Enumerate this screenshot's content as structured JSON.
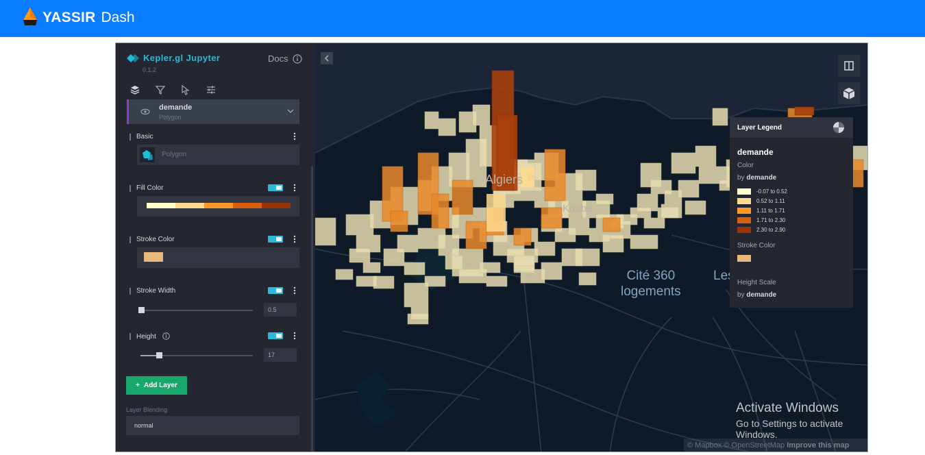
{
  "app": {
    "brand": "YASSIR",
    "title": "Dash"
  },
  "panel": {
    "title": "Kepler.gl Jupyter",
    "version": "0.1.2",
    "docs_label": "Docs",
    "tabs": [
      "layers-icon",
      "filter-icon",
      "interaction-icon",
      "settings-icon"
    ],
    "layer": {
      "name": "demande",
      "type": "Polygon"
    },
    "sections": {
      "basic": {
        "label": "Basic",
        "layer_type": "Polygon"
      },
      "fill_color": {
        "label": "Fill Color",
        "ramp": [
          "#ffffcc",
          "#fed98e",
          "#fe9929",
          "#d95f0e",
          "#993404"
        ]
      },
      "stroke_color": {
        "label": "Stroke Color",
        "color": "#e9b87c"
      },
      "stroke_width": {
        "label": "Stroke Width",
        "value": "0.5"
      },
      "height": {
        "label": "Height",
        "value": "17"
      }
    },
    "add_layer_label": "Add Layer",
    "blending_label": "Layer Blending",
    "blending_value": "normal"
  },
  "legend": {
    "title": "Layer Legend",
    "layer_name": "demande",
    "color_label": "Color",
    "by_label": "by",
    "field": "demande",
    "bins": [
      {
        "label": "-0.07 to 0.52",
        "color": "#ffffcc"
      },
      {
        "label": "0.52 to 1.11",
        "color": "#fed98e"
      },
      {
        "label": "1.11 to 1.71",
        "color": "#fe9929"
      },
      {
        "label": "1.71 to 2.30",
        "color": "#d95f0e"
      },
      {
        "label": "2.30 to 2.90",
        "color": "#993404"
      }
    ],
    "stroke_label": "Stroke Color",
    "stroke_color": "#e9b87c",
    "height_label": "Height Scale"
  },
  "map": {
    "labels": {
      "place1": "Cité 360\nlogements",
      "place2": "Les",
      "place3": "Algiers",
      "place4": "Kouba"
    },
    "attribution": {
      "mapbox": "© Mapbox",
      "osm": "© OpenStreetMap",
      "improve": "Improve this map"
    }
  },
  "watermark": {
    "line1": "Activate Windows",
    "line2": "Go to Settings to activate Windows."
  }
}
